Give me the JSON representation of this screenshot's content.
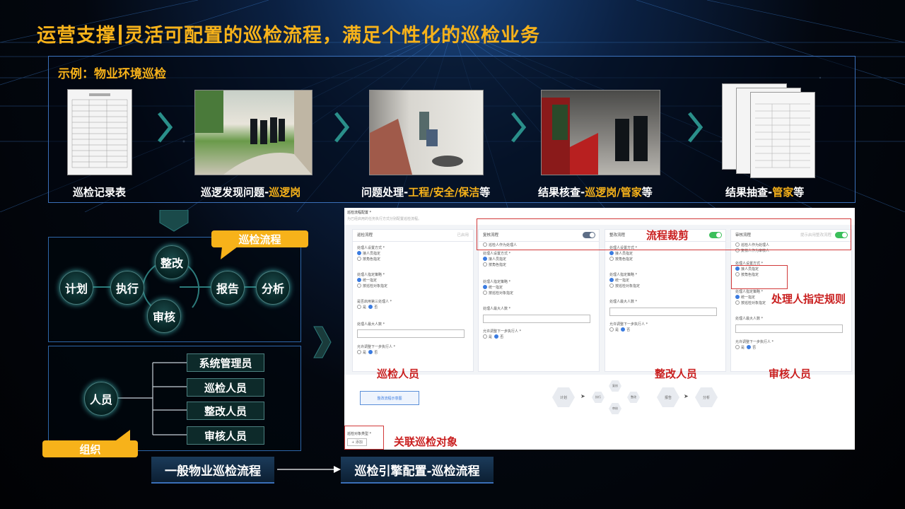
{
  "header": {
    "title_left": "运营支撑",
    "title_right": "灵活可配置的巡检流程，满足个性化的巡检业务"
  },
  "example": {
    "label": "示例：物业环境巡检",
    "steps": [
      {
        "caption_main": "巡检记录表",
        "caption_highlight": "",
        "caption_tail": ""
      },
      {
        "caption_main": "巡逻发现问题-",
        "caption_highlight": "巡逻岗",
        "caption_tail": ""
      },
      {
        "caption_main": "问题处理-",
        "caption_highlight": "工程/安全/保洁",
        "caption_tail": "等"
      },
      {
        "caption_main": "结果核查-",
        "caption_highlight": "巡逻岗/管家",
        "caption_tail": "等"
      },
      {
        "caption_main": "结果抽查-",
        "caption_highlight": "管家",
        "caption_tail": "等"
      }
    ]
  },
  "flow_panel": {
    "callout": "巡检流程",
    "nodes": {
      "plan": "计划",
      "execute": "执行",
      "rectify": "整改",
      "review": "审核",
      "report": "报告",
      "analyze": "分析"
    }
  },
  "org_panel": {
    "callout": "组织",
    "center": "人员",
    "roles": [
      "系统管理员",
      "巡检人员",
      "整改人员",
      "审核人员"
    ]
  },
  "bottom": {
    "left_button": "一般物业巡检流程",
    "right_button": "巡检引擎配置-巡检流程"
  },
  "screen": {
    "page_title": "巡检流程配置 *",
    "page_hint": "为已经启用的任务执行方式分别配置巡检流程。",
    "cards": [
      {
        "title": "巡检流程",
        "right_note": "已启用",
        "toggle": "none"
      },
      {
        "title": "复核流程",
        "right_note": "",
        "toggle": "gray"
      },
      {
        "title": "整改流程",
        "right_note": "",
        "toggle": "on"
      },
      {
        "title": "审核流程",
        "right_note": "提示启用整改流程",
        "toggle": "on"
      }
    ],
    "form": {
      "assign_mode": "处理人设置方式 *",
      "opt_assign": "接人员指定",
      "opt_role": "按角色指定",
      "strategy": "处理人指定策略 *",
      "opt_unified": "统一指定",
      "opt_by_object": "按巡检对象指定",
      "third_party": "是否启用第三处理人 *",
      "yes": "是",
      "no": "否",
      "max_people": "处理人最大人数 *",
      "allow_next": "允许调整下一步执行人 *",
      "as_handler": "巡检人作为处理人",
      "as_reviewer": "复核人作为审核人"
    },
    "flow_button": "整改流程示意图",
    "flow_nodes": {
      "plan": "计划",
      "execute": "执行",
      "recheck": "复核",
      "rectify": "整改",
      "audit": "审核",
      "report": "报告",
      "analyze": "分析"
    },
    "object_type_label": "巡检对象类型 *",
    "add_label": "+ 添加"
  },
  "annotations": {
    "trim": "流程裁剪",
    "rule": "处理人指定规则",
    "inspector": "巡检人员",
    "rectifier": "整改人员",
    "auditor": "审核人员",
    "object": "关联巡检对象"
  },
  "colors": {
    "accent": "#f7b21a",
    "annotation_red": "#c91f1f",
    "panel_border": "#2e66a8"
  }
}
